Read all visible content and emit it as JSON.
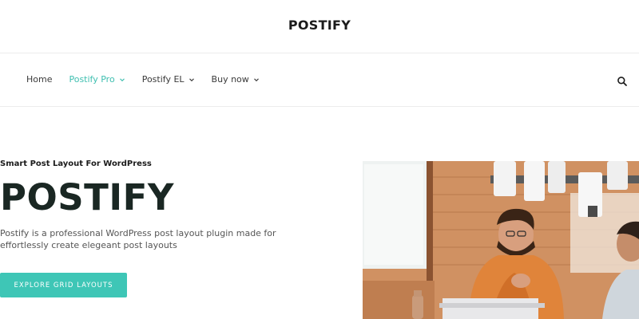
{
  "site": {
    "title": "POSTIFY"
  },
  "nav": {
    "items": [
      {
        "label": "Home",
        "active": false,
        "has_dropdown": false
      },
      {
        "label": "Postify Pro",
        "active": true,
        "has_dropdown": true
      },
      {
        "label": "Postify EL",
        "active": false,
        "has_dropdown": true
      },
      {
        "label": "Buy now",
        "active": false,
        "has_dropdown": true
      }
    ],
    "search_icon": "search-icon"
  },
  "hero": {
    "tagline": "Smart Post Layout For WordPress",
    "title": "POSTIFY",
    "description": "Postify is a professional WordPress post layout plugin made for effortlessly create elegeant post layouts",
    "cta_label": "EXPLORE GRID LAYOUTS"
  },
  "colors": {
    "accent": "#3ec6b6",
    "active_nav": "#3fbfb0",
    "title_dark": "#1a2723"
  }
}
